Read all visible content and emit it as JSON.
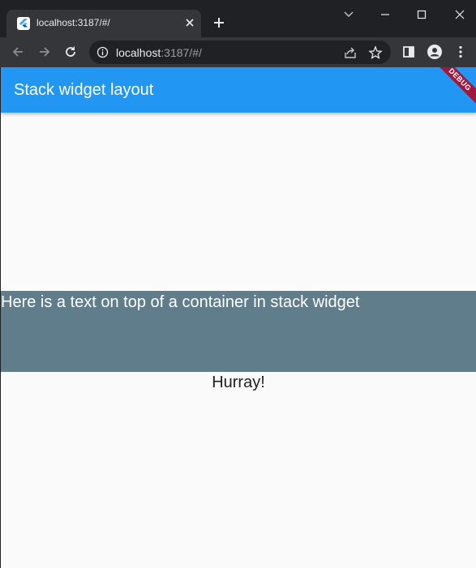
{
  "browser": {
    "tab_title": "localhost:3187/#/",
    "url_host": "localhost",
    "url_rest": ":3187/#/"
  },
  "app": {
    "appbar_title": "Stack widget layout",
    "debug_banner": "DEBUG",
    "stack_text": "Here is a text on top of a container in stack widget",
    "below_text": "Hurray!"
  },
  "colors": {
    "appbar": "#2196f3",
    "stack_container": "#607d8b",
    "debug_banner": "#a0183b"
  }
}
